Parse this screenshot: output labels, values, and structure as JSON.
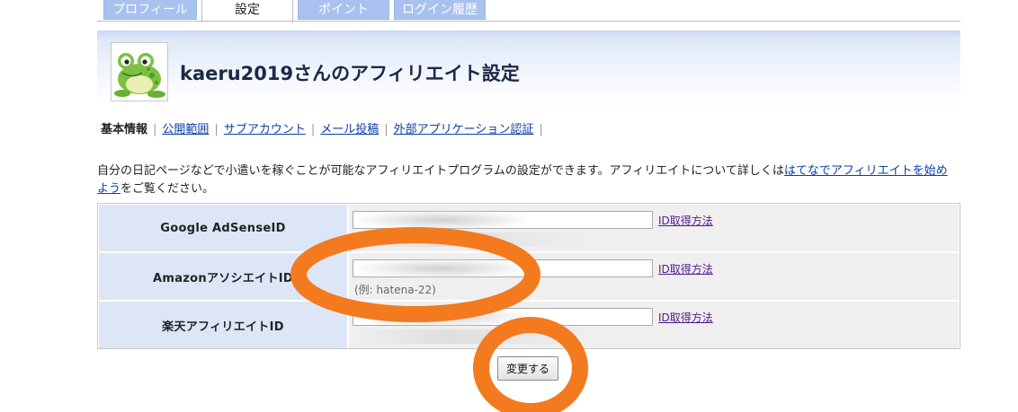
{
  "tabs": [
    {
      "label": "プロフィール"
    },
    {
      "label": "設定"
    },
    {
      "label": "ポイント"
    },
    {
      "label": "ログイン履歴"
    }
  ],
  "header": {
    "title": "kaeru2019さんのアフィリエイト設定",
    "avatar_icon": "frog-avatar-icon"
  },
  "subnav": {
    "current": "基本情報",
    "links": [
      "公開範囲",
      "サブアカウント",
      "メール投稿",
      "外部アプリケーション認証"
    ]
  },
  "description": {
    "text_before": "自分の日記ページなどで小遣いを稼ぐことが可能なアフィリエイトプログラムの設定ができます。アフィリエイトについて詳しくは",
    "link_text": "はてなでアフィリエイトを始めよう",
    "text_after": "をご覧ください。"
  },
  "settings": {
    "rows": [
      {
        "label": "Google AdSenseID",
        "value": "",
        "example": "",
        "link": "ID取得方法"
      },
      {
        "label": "AmazonアソシエイトID",
        "value": "",
        "example": "(例: hatena-22)",
        "link": "ID取得方法"
      },
      {
        "label": "楽天アフィリエイトID",
        "value": "",
        "example": "",
        "link": "ID取得方法"
      }
    ],
    "submit_label": "変更する"
  },
  "colors": {
    "tab_inactive": "#a8c1ef",
    "label_cell": "#dde6f6",
    "field_cell": "#efefef",
    "link": "#0b3ea8",
    "visited_link": "#551a8b",
    "annotation": "#f47a1f"
  }
}
